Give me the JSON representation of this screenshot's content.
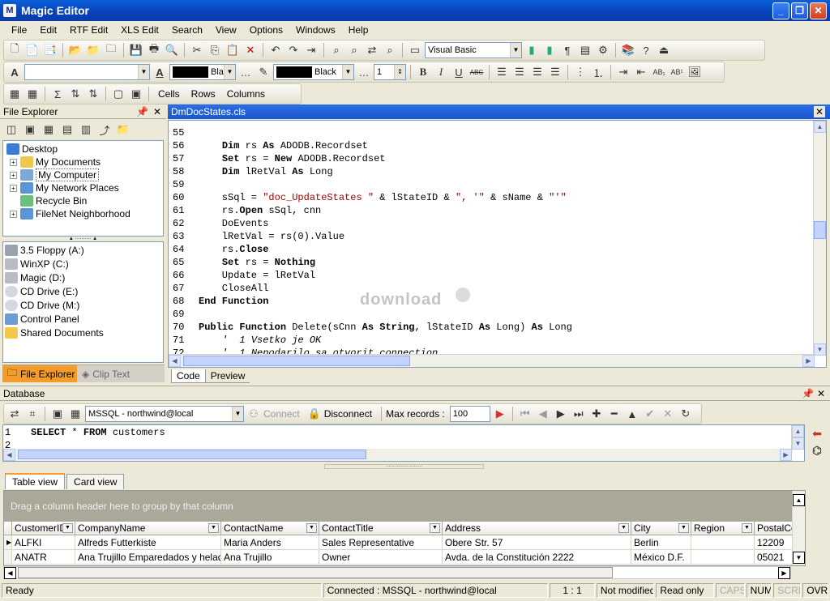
{
  "app": {
    "title": "Magic Editor",
    "logo_letter": "M"
  },
  "menu": [
    "File",
    "Edit",
    "RTF Edit",
    "XLS Edit",
    "Search",
    "View",
    "Options",
    "Windows",
    "Help"
  ],
  "toolbar1": {
    "language": "Visual Basic"
  },
  "toolbar2": {
    "fore_color": "Black",
    "back_color": "Black",
    "spacing": "1"
  },
  "toolbar3": {
    "cells": "Cells",
    "rows": "Rows",
    "columns": "Columns"
  },
  "file_explorer": {
    "title": "File Explorer",
    "tree": [
      {
        "label": "Desktop",
        "expander": ""
      },
      {
        "label": "My Documents",
        "expander": "+"
      },
      {
        "label": "My Computer",
        "expander": "+"
      },
      {
        "label": "My Network Places",
        "expander": "+"
      },
      {
        "label": "Recycle Bin",
        "expander": ""
      },
      {
        "label": "FileNet Neighborhood",
        "expander": "+"
      }
    ],
    "drives": [
      "3.5 Floppy (A:)",
      "WinXP (C:)",
      "Magic (D:)",
      "CD Drive (E:)",
      "CD Drive (M:)",
      "Control Panel",
      "Shared Documents"
    ],
    "tabs": [
      "File Explorer",
      "Clip Text"
    ]
  },
  "editor": {
    "file_name": "DmDocStates.cls",
    "tabs": [
      "Code",
      "Preview"
    ],
    "lines": [
      {
        "n": "55",
        "segs": []
      },
      {
        "n": "56",
        "segs": [
          {
            "t": "    "
          },
          {
            "t": "Dim",
            "k": "kw"
          },
          {
            "t": " rs "
          },
          {
            "t": "As",
            "k": "kw"
          },
          {
            "t": " ADODB.Recordset"
          }
        ]
      },
      {
        "n": "57",
        "segs": [
          {
            "t": "    "
          },
          {
            "t": "Set",
            "k": "kw"
          },
          {
            "t": " rs = "
          },
          {
            "t": "New",
            "k": "kw"
          },
          {
            "t": " ADODB.Recordset"
          }
        ]
      },
      {
        "n": "58",
        "segs": [
          {
            "t": "    "
          },
          {
            "t": "Dim",
            "k": "kw"
          },
          {
            "t": " lRetVal "
          },
          {
            "t": "As",
            "k": "kw"
          },
          {
            "t": " Long"
          }
        ]
      },
      {
        "n": "59",
        "segs": []
      },
      {
        "n": "60",
        "segs": [
          {
            "t": "    sSql = "
          },
          {
            "t": "\"doc_UpdateStates \"",
            "k": "str"
          },
          {
            "t": " & lStateID & "
          },
          {
            "t": "\", '\"",
            "k": "str"
          },
          {
            "t": " & sName & "
          },
          {
            "t": "\"'\"",
            "k": "str"
          }
        ]
      },
      {
        "n": "61",
        "segs": [
          {
            "t": "    rs."
          },
          {
            "t": "Open",
            "k": "kw"
          },
          {
            "t": " sSql, cnn"
          }
        ]
      },
      {
        "n": "62",
        "segs": [
          {
            "t": "    DoEvents"
          }
        ]
      },
      {
        "n": "63",
        "segs": [
          {
            "t": "    lRetVal = rs(0).Value"
          }
        ]
      },
      {
        "n": "64",
        "segs": [
          {
            "t": "    rs."
          },
          {
            "t": "Close",
            "k": "kw"
          }
        ]
      },
      {
        "n": "65",
        "segs": [
          {
            "t": "    "
          },
          {
            "t": "Set",
            "k": "kw"
          },
          {
            "t": " rs = "
          },
          {
            "t": "Nothing",
            "k": "kw"
          }
        ]
      },
      {
        "n": "66",
        "segs": [
          {
            "t": "    Update = lRetVal"
          }
        ]
      },
      {
        "n": "67",
        "segs": [
          {
            "t": "    CloseAll"
          }
        ]
      },
      {
        "n": "68",
        "segs": [
          {
            "t": "End Function",
            "k": "kw"
          }
        ]
      },
      {
        "n": "69",
        "segs": []
      },
      {
        "n": "70",
        "segs": [
          {
            "t": "Public Function",
            "k": "kw"
          },
          {
            "t": " Delete(sCnn "
          },
          {
            "t": "As String",
            "k": "kw"
          },
          {
            "t": ", lStateID "
          },
          {
            "t": "As",
            "k": "kw"
          },
          {
            "t": " Long) "
          },
          {
            "t": "As",
            "k": "kw"
          },
          {
            "t": " Long"
          }
        ]
      },
      {
        "n": "71",
        "segs": [
          {
            "t": "    "
          },
          {
            "t": "'  1 Vsetko je OK",
            "k": "cmt"
          }
        ]
      },
      {
        "n": "72",
        "segs": [
          {
            "t": "    "
          },
          {
            "t": "'  1 Nepodarilo sa otvorit connection",
            "k": "cmt"
          }
        ]
      }
    ],
    "watermark": "download"
  },
  "database": {
    "title": "Database",
    "connection": "MSSQL - northwind@local",
    "connect": "Connect",
    "disconnect": "Disconnect",
    "max_records_label": "Max records :",
    "max_records": "100",
    "sql_lines": [
      {
        "n": "1",
        "segs": [
          {
            "t": "SELECT",
            "k": "kw"
          },
          {
            "t": " * "
          },
          {
            "t": "FROM",
            "k": "kw"
          },
          {
            "t": " customers"
          }
        ]
      },
      {
        "n": "2",
        "segs": []
      }
    ],
    "view_tabs": [
      "Table view",
      "Card view"
    ],
    "group_hint": "Drag a column header here to group by that column",
    "columns": [
      "CustomerID",
      "CompanyName",
      "ContactName",
      "ContactTitle",
      "Address",
      "City",
      "Region",
      "PostalCode"
    ],
    "rows": [
      [
        "ALFKI",
        "Alfreds Futterkiste",
        "Maria Anders",
        "Sales Representative",
        "Obere Str. 57",
        "Berlin",
        "",
        "12209"
      ],
      [
        "ANATR",
        "Ana Trujillo Emparedados y helados",
        "Ana Trujillo",
        "Owner",
        "Avda. de la Constitución 2222",
        "México D.F.",
        "",
        "05021"
      ]
    ]
  },
  "status": {
    "ready": "Ready",
    "connected": "Connected : MSSQL - northwind@local",
    "position": "1 : 1",
    "modified": "Not modified",
    "mode": "Read only",
    "caps": "CAPS",
    "num": "NUM",
    "scrl": "SCRL",
    "ovr": "OVR"
  }
}
